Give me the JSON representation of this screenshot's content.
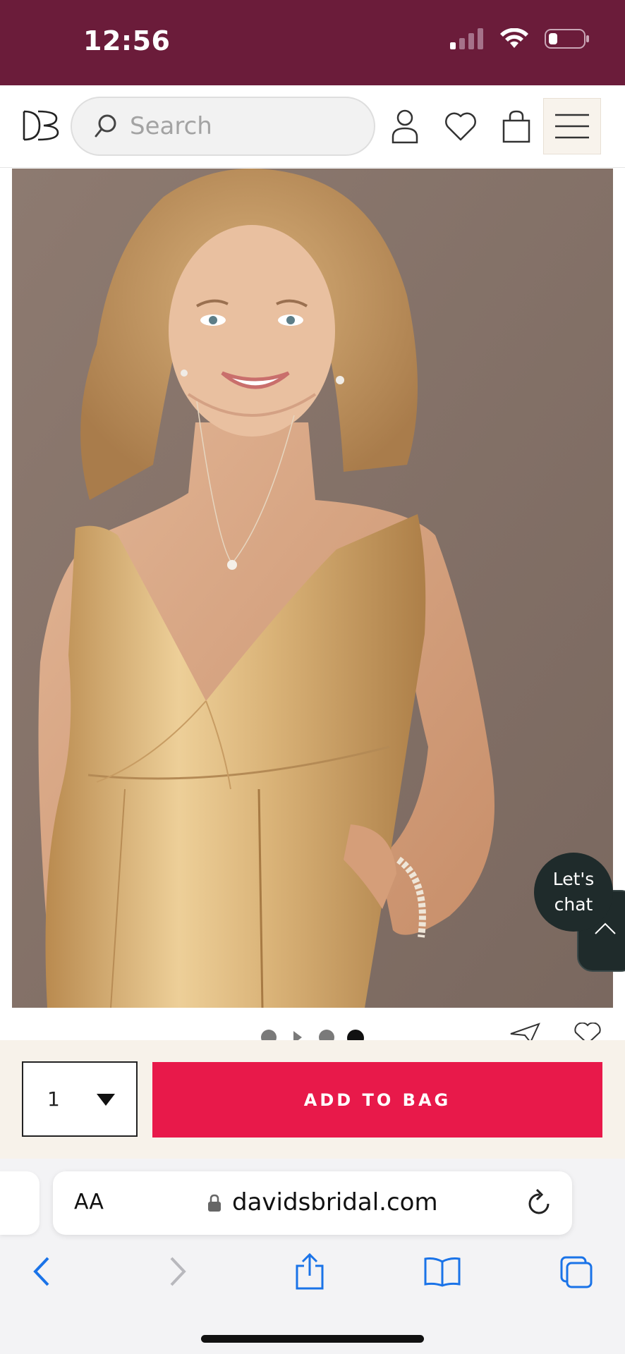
{
  "status_bar": {
    "time": "12:56"
  },
  "header": {
    "logo_text": "DB",
    "search_placeholder": "Search"
  },
  "chat": {
    "line1": "Let's",
    "line2": "chat"
  },
  "purchase": {
    "quantity": "1",
    "add_to_bag_label": "ADD TO BAG"
  },
  "browser": {
    "text_size_label": "AA",
    "url": "davidsbridal.com"
  },
  "colors": {
    "status_bar_bg": "#6b1c3a",
    "accent_button": "#e8194a",
    "buy_bar_bg": "#f7f2ea",
    "chat_bg": "#1f2b2b",
    "browser_blue": "#1a73e8"
  },
  "icons": {
    "status": [
      "signal-icon",
      "wifi-icon",
      "battery-icon"
    ],
    "header": [
      "search-icon",
      "account-icon",
      "wishlist-heart-icon",
      "shopping-bag-icon",
      "hamburger-menu-icon"
    ],
    "carousel": [
      "share-icon",
      "favorite-heart-icon"
    ],
    "browser": [
      "lock-icon",
      "reload-icon",
      "back-icon",
      "forward-icon",
      "share-icon",
      "bookmarks-icon",
      "tabs-icon"
    ]
  },
  "carousel": {
    "slide_count": 4,
    "active_slide": 4
  }
}
